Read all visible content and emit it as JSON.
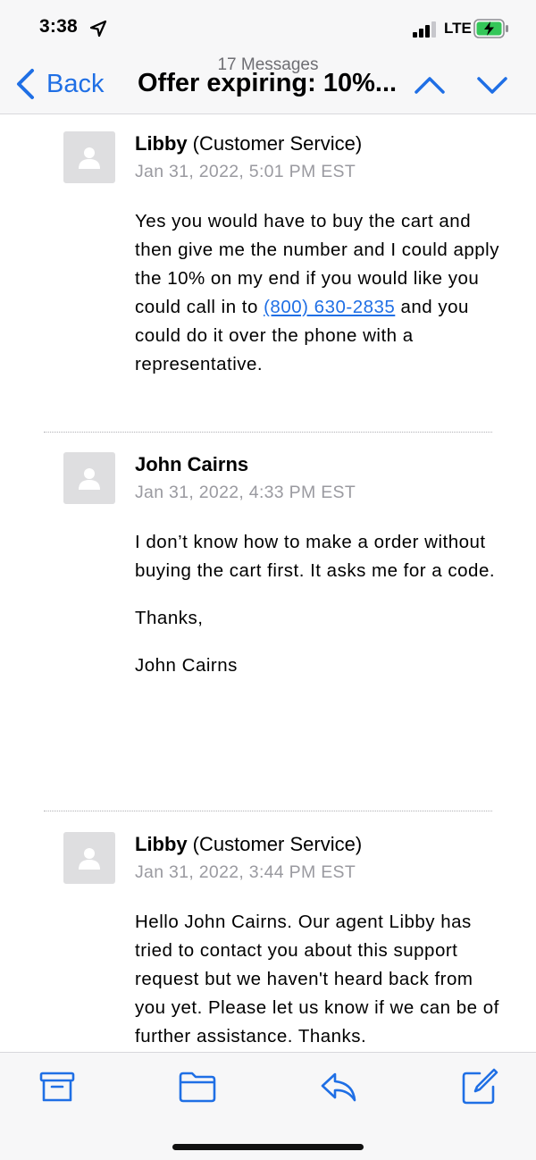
{
  "status_bar": {
    "time": "3:38",
    "network": "LTE",
    "icons": [
      "location-arrow-icon",
      "signal-bars-icon",
      "battery-charging-icon"
    ]
  },
  "nav": {
    "back_label": "Back",
    "message_count": "17 Messages",
    "title": "Offer expiring: 10%...",
    "icons": [
      "chevron-left-icon",
      "chevron-up-icon",
      "chevron-down-icon"
    ]
  },
  "messages": [
    {
      "sender": "Libby",
      "role": "(Customer Service)",
      "timestamp": "Jan 31, 2022, 5:01 PM EST",
      "body_before_link": "Yes you would have to buy the cart and then give me the number and I could apply the 10% on my end if you would like you could call in to ",
      "phone": "(800) 630-2835",
      "body_after_link": " and you could do it over the phone with a representative."
    },
    {
      "sender": "John Cairns",
      "role": "",
      "timestamp": "Jan 31, 2022, 4:33 PM EST",
      "paragraphs": [
        "I don’t know how to make a order without buying the cart first. It asks me for a code.",
        "Thanks,",
        "John Cairns"
      ]
    },
    {
      "sender": "Libby",
      "role": "(Customer Service)",
      "timestamp": "Jan 31, 2022, 3:44 PM EST",
      "body": "Hello John Cairns. Our agent Libby has tried to contact you about this support request but we haven't heard back from you yet. Please let us know if we can be of further assistance. Thanks."
    }
  ],
  "toolbar": {
    "icons": [
      "archive-icon",
      "folder-icon",
      "reply-icon",
      "compose-icon"
    ]
  },
  "colors": {
    "accent": "#1f6fe5",
    "secondary_text": "#9a9aa0",
    "bar_background": "#f7f7f8",
    "avatar_background": "#dedee0"
  }
}
